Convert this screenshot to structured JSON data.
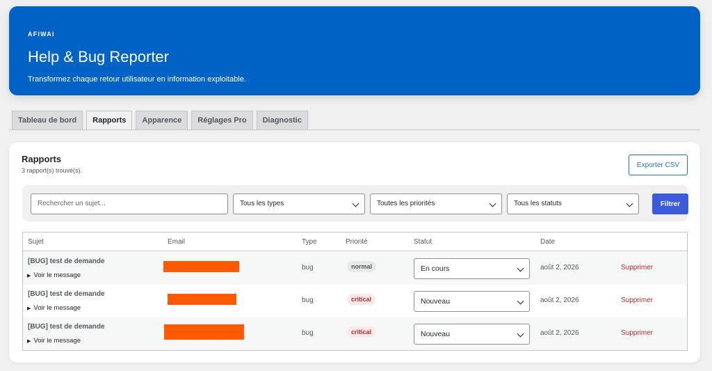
{
  "header": {
    "brand": "AFIWAI",
    "title": "Help & Bug Reporter",
    "subtitle": "Transformez chaque retour utilisateur en information exploitable.",
    "accent_color": "#0062c4"
  },
  "tabs": [
    {
      "label": "Tableau de bord",
      "active": false
    },
    {
      "label": "Rapports",
      "active": true
    },
    {
      "label": "Apparence",
      "active": false
    },
    {
      "label": "Réglages Pro",
      "active": false
    },
    {
      "label": "Diagnostic",
      "active": false
    }
  ],
  "reports": {
    "title": "Rapports",
    "count_text": "3 rapport(s) trouvé(s).",
    "export_label": "Exporter CSV",
    "filters": {
      "search_placeholder": "Rechercher un sujet...",
      "type_value": "Tous les types",
      "priority_value": "Toutes les priorités",
      "status_value": "Tous les statuts",
      "filter_label": "Filtrer"
    },
    "columns": [
      "Sujet",
      "Email",
      "Type",
      "Priorité",
      "Statut",
      "Date"
    ],
    "rows": [
      {
        "subject": "[BUG] test de demande",
        "toggle": "Voir le message",
        "email": "",
        "type": "bug",
        "priority": "normal",
        "status": "En cours",
        "date": "août 2, 2026",
        "delete": "Supprimer"
      },
      {
        "subject": "[BUG] test de demande",
        "toggle": "Voir le message",
        "email": "",
        "type": "bug",
        "priority": "critical",
        "status": "Nouveau",
        "date": "août 2, 2026",
        "delete": "Supprimer"
      },
      {
        "subject": "[BUG] test de demande",
        "toggle": "Voir le message",
        "email": "",
        "type": "bug",
        "priority": "critical",
        "status": "Nouveau",
        "date": "août 2, 2026",
        "delete": "Supprimer"
      }
    ],
    "redaction_color": "#ff5a00",
    "danger_color": "#b32d2e",
    "primary_button_color": "#3b5bdb"
  }
}
